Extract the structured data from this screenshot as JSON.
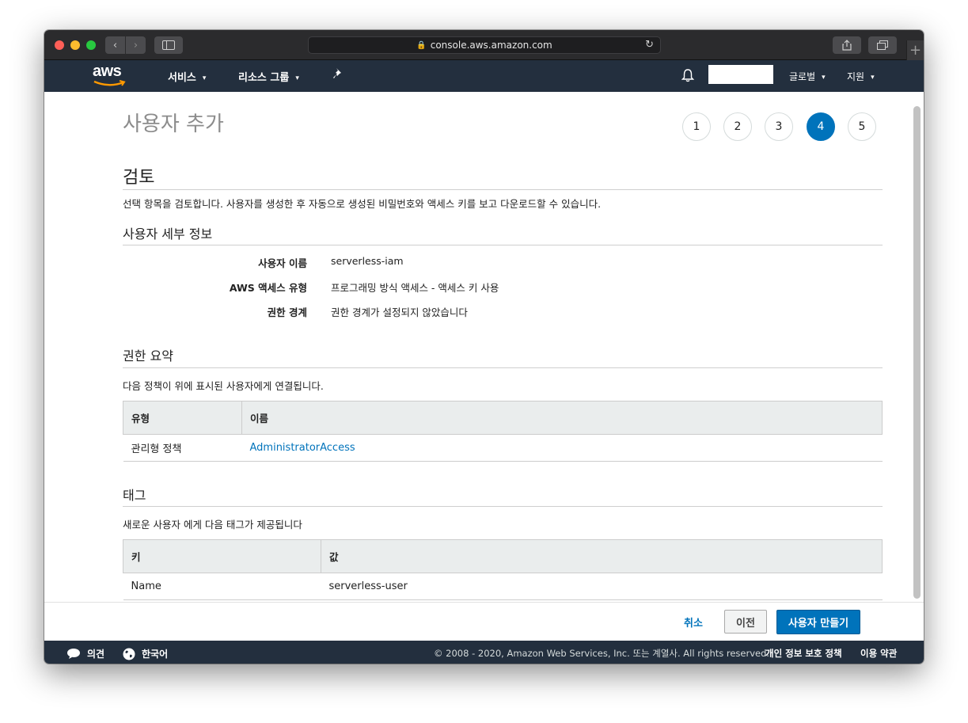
{
  "browser": {
    "url": "console.aws.amazon.com"
  },
  "topnav": {
    "logo_text": "aws",
    "services_label": "서비스",
    "resource_groups_label": "리소스 그룹",
    "global_label": "글로벌",
    "support_label": "지원"
  },
  "page": {
    "title": "사용자 추가",
    "steps": [
      "1",
      "2",
      "3",
      "4",
      "5"
    ],
    "active_step": 4
  },
  "review": {
    "heading": "검토",
    "description": "선택 항목을 검토합니다. 사용자를 생성한 후 자동으로 생성된 비밀번호와 액세스 키를 보고 다운로드할 수 있습니다.",
    "user_details": {
      "heading": "사용자 세부 정보",
      "rows": [
        {
          "label": "사용자 이름",
          "value": "serverless-iam"
        },
        {
          "label": "AWS 액세스 유형",
          "value": "프로그래밍 방식 액세스 - 액세스 키 사용"
        },
        {
          "label": "권한 경계",
          "value": "권한 경계가 설정되지 않았습니다"
        }
      ]
    },
    "permissions": {
      "heading": "권한 요약",
      "description": "다음 정책이 위에 표시된 사용자에게 연결됩니다.",
      "columns": [
        "유형",
        "이름"
      ],
      "rows": [
        {
          "type": "관리형 정책",
          "name": "AdministratorAccess"
        }
      ]
    },
    "tags": {
      "heading": "태그",
      "description": "새로운 사용자 에게 다음 태그가 제공됩니다",
      "columns": [
        "키",
        "값"
      ],
      "rows": [
        {
          "key": "Name",
          "value": "serverless-user"
        }
      ]
    }
  },
  "actions": {
    "cancel_label": "취소",
    "previous_label": "이전",
    "create_label": "사용자 만들기"
  },
  "footer": {
    "feedback_label": "의견",
    "language_label": "한국어",
    "copyright": "© 2008 - 2020, Amazon Web Services, Inc. 또는 계열사. All rights reserved.",
    "privacy_label": "개인 정보 보호 정책",
    "terms_label": "이용 약관"
  },
  "colors": {
    "nav_bg": "#232f3e",
    "accent": "#0073bb"
  }
}
